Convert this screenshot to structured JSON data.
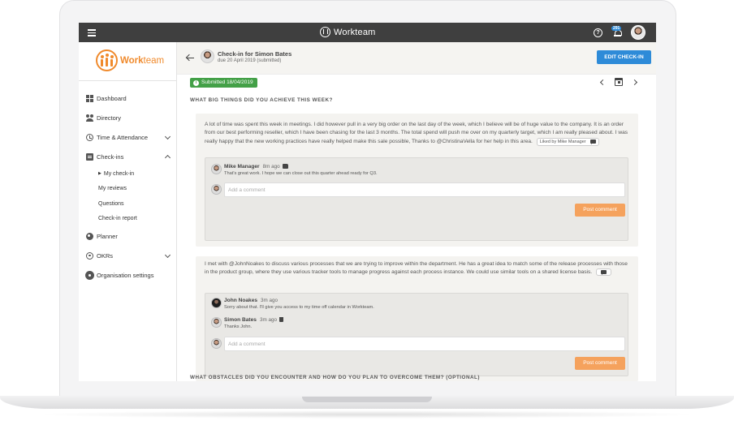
{
  "topbar": {
    "brand": "Workteam",
    "notification_count": "291"
  },
  "sidebar": {
    "logo_text_a": "Work",
    "logo_text_b": "team",
    "items": [
      {
        "label": "Dashboard"
      },
      {
        "label": "Directory"
      },
      {
        "label": "Time & Attendance"
      },
      {
        "label": "Check-ins"
      },
      {
        "label": "Planner"
      },
      {
        "label": "OKRs"
      },
      {
        "label": "Organisation settings"
      }
    ],
    "checkins_sub": [
      {
        "label": "My check-in"
      },
      {
        "label": "My reviews"
      },
      {
        "label": "Questions"
      },
      {
        "label": "Check-in report"
      }
    ]
  },
  "header": {
    "title": "Check-in for Simon Bates",
    "subtitle": "due 20 April 2019 (submitted)",
    "edit_button": "EDIT CHECK-IN"
  },
  "status": {
    "label": "Submitted 18/04/2019"
  },
  "sections": [
    {
      "label": "WHAT BIG THINGS DID YOU ACHIEVE THIS WEEK?"
    },
    {
      "label": "WHAT OBSTACLES DID YOU ENCOUNTER AND HOW DO YOU PLAN TO OVERCOME THEM? (OPTIONAL)"
    }
  ],
  "answers": [
    {
      "text": "A lot of time was spent this week in meetings. I did however pull in a very big order on the last day of the week, which I believe will be of huge value to the company. It is an order from our best performing reseller, which I have been chasing for the last 3 months. The total spend will push me over on my quarterly target, which I am really pleased about. I was really happy that the new working practices have really helped make this sale possible, Thanks to @ChristinaVella for her help in this area.",
      "liked_by": "Liked by Mike Manager",
      "comments": [
        {
          "name": "Mike Manager",
          "time": "8m ago",
          "text": "That's great work. I hope we can close out this quarter ahead ready for Q3."
        }
      ],
      "add_placeholder": "Add a comment",
      "post_label": "Post comment"
    },
    {
      "text": "I met with @JohnNoakes to discuss various processes that we are trying to improve within the department. He has a great idea to match some of the release processes with those in the product group, where they use various tracker tools to manage progress against each process instance. We could use similar tools on a shared license basis.",
      "comments": [
        {
          "name": "John Noakes",
          "time": "3m ago",
          "text": "Sorry about that. I'll give you access to my time off calendar in Workteam."
        },
        {
          "name": "Simon Bates",
          "time": "3m ago",
          "text": "Thanks John."
        }
      ],
      "add_placeholder": "Add a comment",
      "post_label": "Post comment"
    }
  ],
  "colors": {
    "brand_orange": "#f08a2c",
    "accent_blue": "#2e8bd8",
    "success_green": "#43a047",
    "post_orange": "#f5a25d"
  }
}
